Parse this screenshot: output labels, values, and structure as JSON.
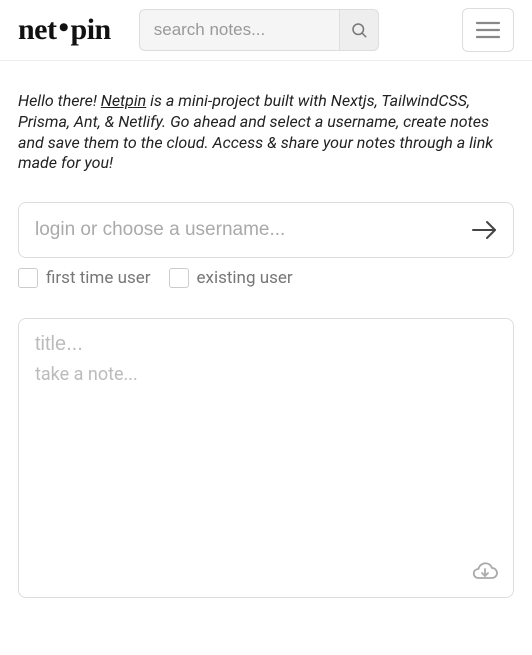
{
  "header": {
    "logo_left": "net",
    "logo_right": "pin",
    "search_placeholder": "search notes..."
  },
  "intro": {
    "greeting": "Hello there!",
    "link_text": "Netpin",
    "rest": " is a mini-project built with Nextjs, TailwindCSS, Prisma, Ant, & Netlify. Go ahead and select a username, create notes and save them to the cloud. Access & share your notes through a link made for you!"
  },
  "login": {
    "placeholder": "login or choose a username...",
    "check_first": "first time user",
    "check_existing": "existing user"
  },
  "note": {
    "title_placeholder": "title...",
    "body_placeholder": "take a note..."
  }
}
